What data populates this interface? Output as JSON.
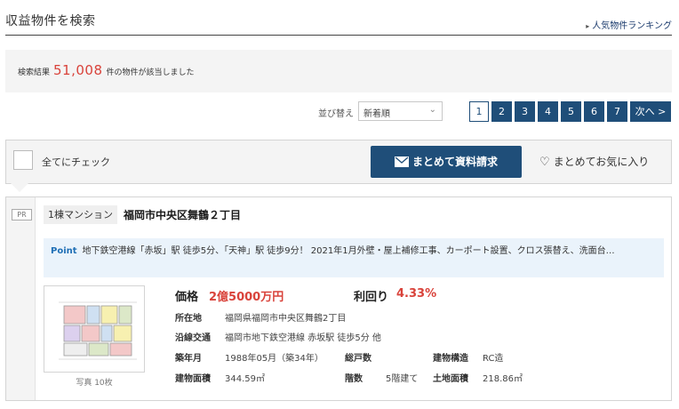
{
  "header": {
    "title": "収益物件を検索",
    "ranking_link": "人気物件ランキング"
  },
  "results": {
    "prefix": "検索結果",
    "count": "51,008",
    "suffix": "件の物件が該当しました"
  },
  "sort": {
    "label": "並び替え",
    "selected": "新着順"
  },
  "pagination": {
    "pages": [
      "1",
      "2",
      "3",
      "4",
      "5",
      "6",
      "7"
    ],
    "current": "1",
    "next_label": "次へ >"
  },
  "bulk": {
    "check_all_label": "全てにチェック",
    "request_label": "まとめて資料請求",
    "favorite_label": "まとめてお気に入り"
  },
  "listing": {
    "pr_badge": "PR",
    "type": "1棟マンション",
    "title": "福岡市中央区舞鶴２丁目",
    "point_label": "Point",
    "point_text": "地下鉄空港線「赤坂」駅 徒歩5分、「天神」駅 徒歩9分！ 2021年1月外壁・屋上補修工事、カーポート設置、クロス張替え、洗面台…",
    "photo_count": "写真 10枚",
    "price_label": "価格",
    "price": "2億5000万円",
    "yield_label": "利回り",
    "yield": "4.33%",
    "address_label": "所在地",
    "address": "福岡県福岡市中央区舞鶴2丁目",
    "access_label": "沿線交通",
    "access": "福岡市地下鉄空港線 赤坂駅 徒歩5分 他",
    "built_label": "築年月",
    "built": "1988年05月（築34年）",
    "units_label": "総戸数",
    "units": "",
    "structure_label": "建物構造",
    "structure": "RC造",
    "building_area_label": "建物面積",
    "building_area": "344.59㎡",
    "floors_label": "階数",
    "floors": "5階建て",
    "land_area_label": "土地面積",
    "land_area": "218.86㎡"
  },
  "colors": {
    "accent_navy": "#1f4e79",
    "price_red": "#d9433b",
    "point_blue": "#1f6fb5"
  }
}
